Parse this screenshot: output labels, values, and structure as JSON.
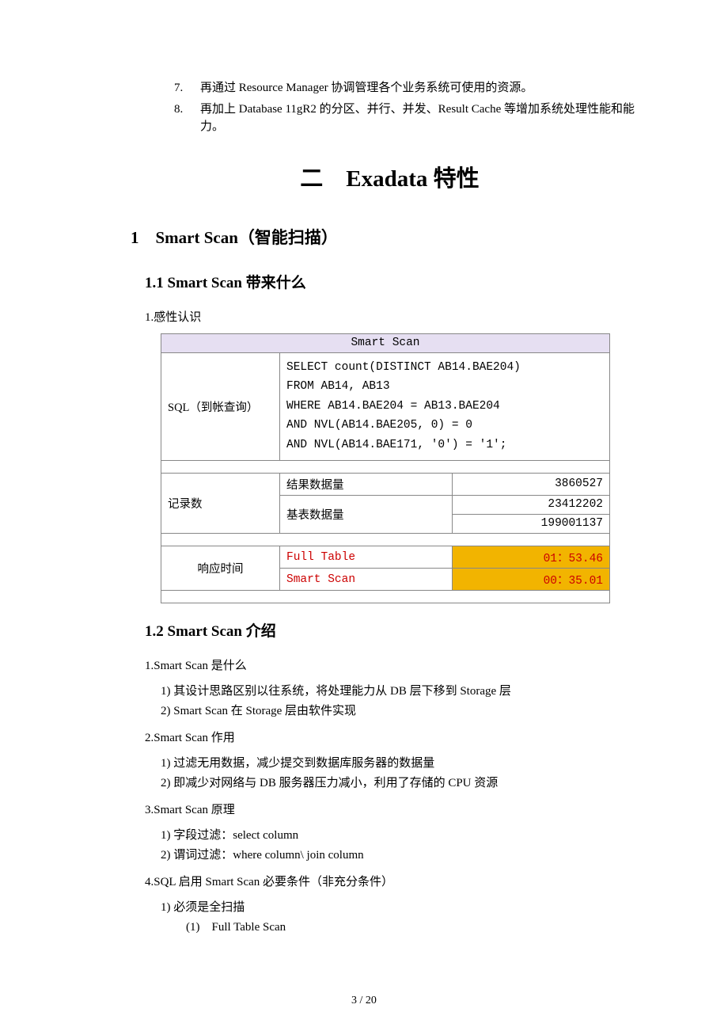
{
  "top_list": {
    "start": 7,
    "items": [
      "再通过 Resource Manager 协调管理各个业务系统可使用的资源。",
      "再加上 Database 11gR2 的分区、并行、并发、Result Cache 等增加系统处理性能和能力。"
    ]
  },
  "main_heading": "二　Exadata 特性",
  "section1": {
    "h2": "1　Smart Scan（智能扫描）",
    "h3_1": "1.1 Smart Scan 带来什么",
    "sub1": "1.感性认识",
    "table": {
      "header": "Smart Scan",
      "sql_label": "SQL（到帐查询）",
      "sql_lines": [
        "SELECT count(DISTINCT AB14.BAE204)",
        "  FROM AB14, AB13",
        " WHERE AB14.BAE204 = AB13.BAE204",
        "   AND NVL(AB14.BAE205, 0) = 0",
        "   AND NVL(AB14.BAE171, '0') = '1';"
      ],
      "records_label": "记录数",
      "result_qty_label": "结果数据量",
      "result_qty_value": "3860527",
      "base_qty_label": "基表数据量",
      "base_qty_values": [
        "23412202",
        "199001137"
      ],
      "resp_label": "响应时间",
      "full_label": "Full Table",
      "full_value": "01：53.46",
      "smart_label": "Smart Scan",
      "smart_value": "00：35.01"
    },
    "h3_2": "1.2 Smart Scan 介绍",
    "intro_items": [
      {
        "title": "1.Smart Scan 是什么",
        "subs": [
          "1) 其设计思路区别以往系统，将处理能力从 DB 层下移到 Storage 层",
          "2) Smart Scan 在 Storage 层由软件实现"
        ]
      },
      {
        "title": "2.Smart Scan 作用",
        "subs": [
          "1) 过滤无用数据，减少提交到数据库服务器的数据量",
          "2) 即减少对网络与 DB 服务器压力减小，利用了存储的 CPU 资源"
        ]
      },
      {
        "title": "3.Smart Scan 原理",
        "subs": [
          "1) 字段过滤：select column",
          "2) 谓词过滤：where column\\ join column"
        ]
      },
      {
        "title": "4.SQL 启用 Smart Scan 必要条件（非充分条件）",
        "subs": [
          "1) 必须是全扫描"
        ],
        "subsubs": [
          "(1)　Full Table Scan"
        ]
      }
    ]
  },
  "page_number": "3 / 20"
}
